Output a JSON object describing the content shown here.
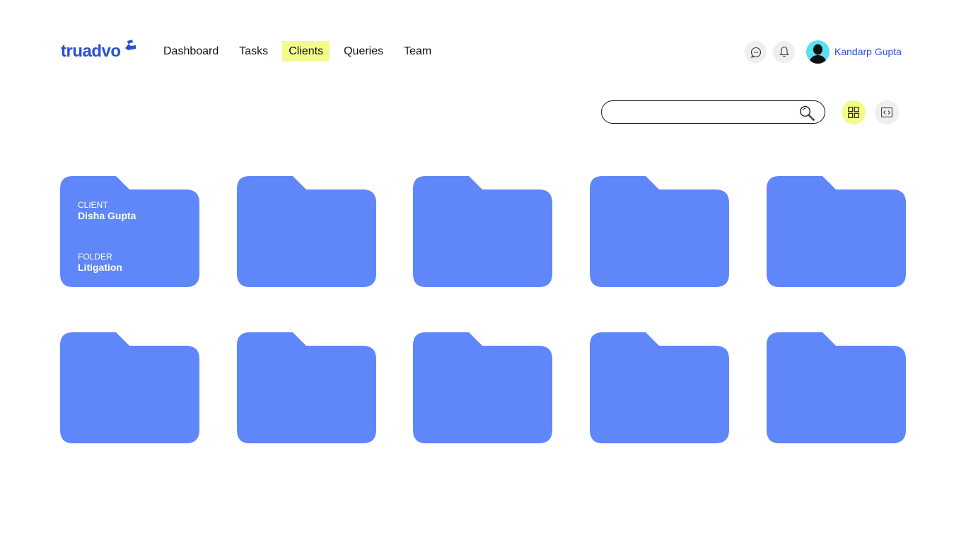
{
  "brand": {
    "logo_text": "truadvo",
    "accent": "#2a4fd6",
    "highlight": "#f3fb8a",
    "folder_color": "#5f87fa"
  },
  "nav": {
    "items": [
      {
        "label": "Dashboard",
        "active": false
      },
      {
        "label": "Tasks",
        "active": false
      },
      {
        "label": "Clients",
        "active": true
      },
      {
        "label": "Queries",
        "active": false
      },
      {
        "label": "Team",
        "active": false
      }
    ]
  },
  "header": {
    "chat_icon": "chat-bubble-icon",
    "bell_icon": "bell-icon",
    "user_name": "Kandarp Gupta"
  },
  "toolbar": {
    "search_placeholder": "",
    "search_value": "",
    "grid_view_icon": "grid-icon",
    "code_view_icon": "code-icon",
    "active_view": "grid"
  },
  "folders": [
    {
      "client_label": "CLIENT",
      "client_name": "Disha Gupta",
      "folder_label": "FOLDER",
      "folder_name": "Litigation"
    },
    {},
    {},
    {},
    {},
    {},
    {},
    {},
    {},
    {}
  ]
}
